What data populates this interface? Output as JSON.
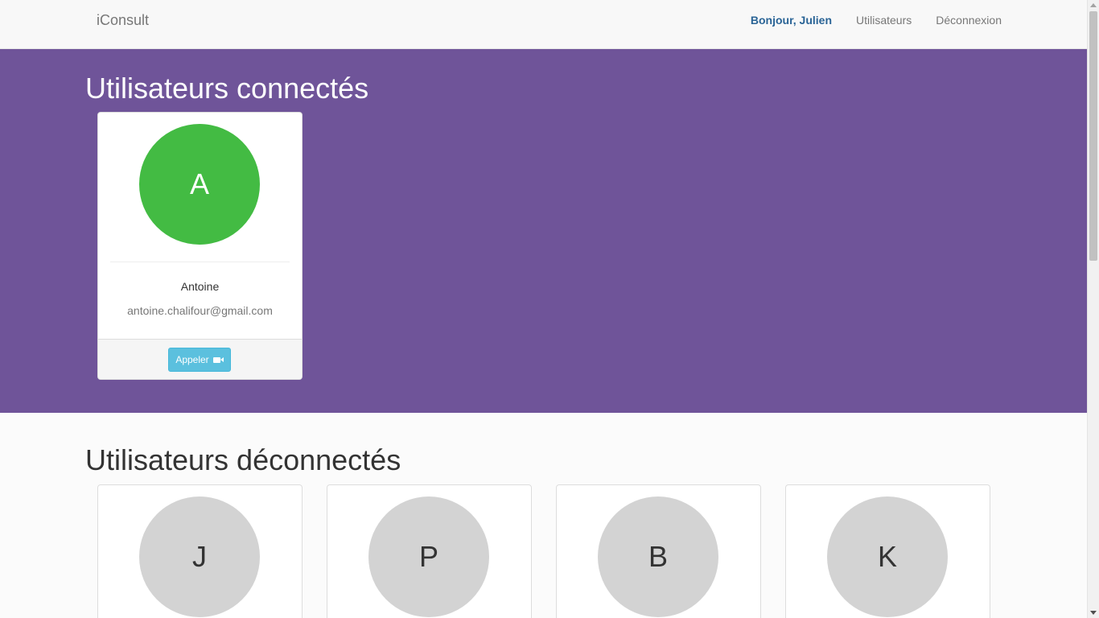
{
  "navbar": {
    "brand": "iConsult",
    "greeting": "Bonjour, Julien",
    "users_link": "Utilisateurs",
    "logout_link": "Déconnexion"
  },
  "online": {
    "title": "Utilisateurs connectés",
    "users": [
      {
        "initial": "A",
        "name": "Antoine",
        "email": "antoine.chalifour@gmail.com",
        "call_label": "Appeler",
        "avatar_color": "#43bb43"
      }
    ]
  },
  "offline": {
    "title": "Utilisateurs déconnectés",
    "users": [
      {
        "initial": "J"
      },
      {
        "initial": "P"
      },
      {
        "initial": "B"
      },
      {
        "initial": "K"
      }
    ]
  },
  "colors": {
    "online_bg": "#6f5499",
    "call_button": "#5bc0de",
    "offline_avatar": "#d3d3d3"
  }
}
